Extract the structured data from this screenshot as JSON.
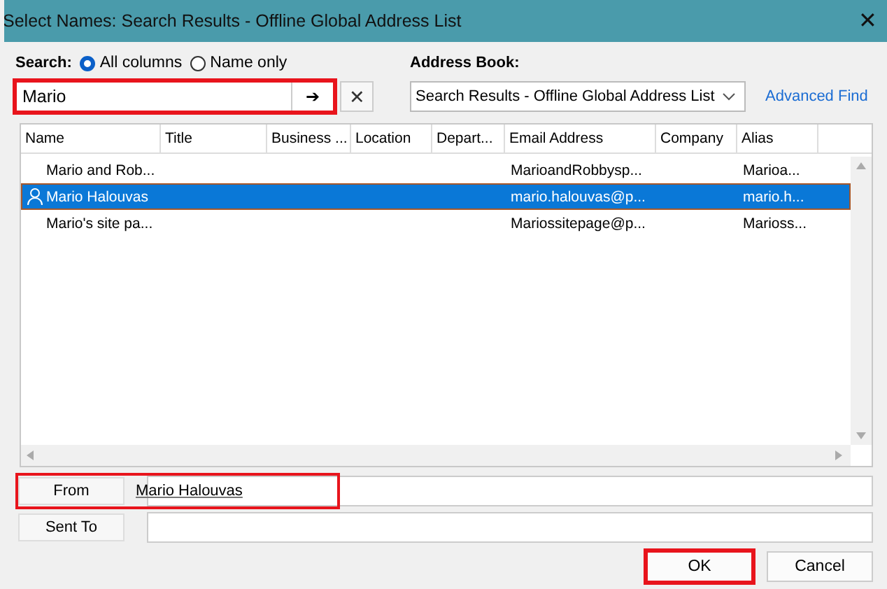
{
  "window": {
    "title": "Select Names: Search Results - Offline Global Address List",
    "close": "✕"
  },
  "search": {
    "label": "Search:",
    "options": [
      {
        "label": "All columns",
        "selected": true
      },
      {
        "label": "Name only",
        "selected": false
      }
    ],
    "value": "Mario",
    "go": "➔",
    "clear": "✕",
    "highlighted": true
  },
  "address_book": {
    "label": "Address Book:",
    "value": "Search Results - Offline Global Address List",
    "advanced": "Advanced Find"
  },
  "table": {
    "columns": [
      "Name",
      "Title",
      "Business ...",
      "Location",
      "Depart...",
      "Email Address",
      "Company",
      "Alias"
    ],
    "rows": [
      {
        "kind": "group",
        "selected": false,
        "cells": [
          "Mario and Rob...",
          null,
          null,
          null,
          null,
          "MarioandRobbysp...",
          null,
          "Marioa..."
        ]
      },
      {
        "kind": "person",
        "selected": true,
        "cells": [
          "Mario Halouvas",
          null,
          null,
          null,
          null,
          "mario.halouvas@p...",
          null,
          "mario.h..."
        ]
      },
      {
        "kind": "group",
        "selected": false,
        "cells": [
          "Mario's site pa...",
          null,
          null,
          null,
          null,
          "Mariossitepage@p...",
          null,
          "Marioss..."
        ]
      }
    ]
  },
  "recipients": [
    {
      "label": "From",
      "value": "Mario Halouvas",
      "highlighted": true
    },
    {
      "label": "Sent To",
      "highlighted": false
    }
  ],
  "buttons": [
    {
      "label": "OK",
      "highlighted": true
    },
    {
      "label": "Cancel",
      "highlighted": false
    }
  ]
}
